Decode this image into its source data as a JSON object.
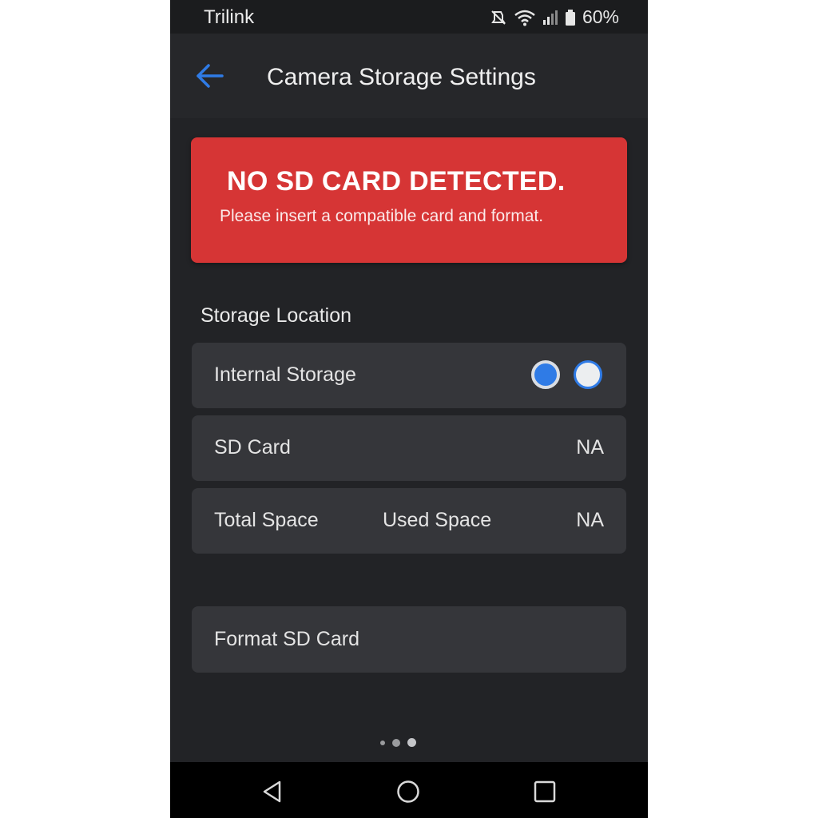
{
  "status_bar": {
    "carrier": "Trilink",
    "battery": "60%",
    "icons": [
      "mute-icon",
      "wifi-icon",
      "signal-icon",
      "battery-icon"
    ]
  },
  "app_bar": {
    "back_icon": "back-arrow-icon",
    "title": "Camera Storage Settings"
  },
  "alert": {
    "title": "NO SD CARD DETECTED.",
    "message": "Please insert a compatible card and format.",
    "color": "#d63535"
  },
  "storage": {
    "section_label": "Storage Location",
    "internal": {
      "label": "Internal Storage",
      "selected_option": 1
    },
    "sd_card": {
      "label": "SD Card",
      "value": "NA"
    },
    "space": {
      "total_label": "Total Space",
      "used_label": "Used Space",
      "value": "NA"
    }
  },
  "format_button": {
    "label": "Format SD Card"
  },
  "page_indicator": {
    "count": 3,
    "active": 3
  },
  "nav_bar": {
    "icons": [
      "back-triangle-icon",
      "home-circle-icon",
      "recents-square-icon"
    ]
  },
  "colors": {
    "accent": "#2f7be6",
    "background": "#222326",
    "card": "#35363a"
  }
}
